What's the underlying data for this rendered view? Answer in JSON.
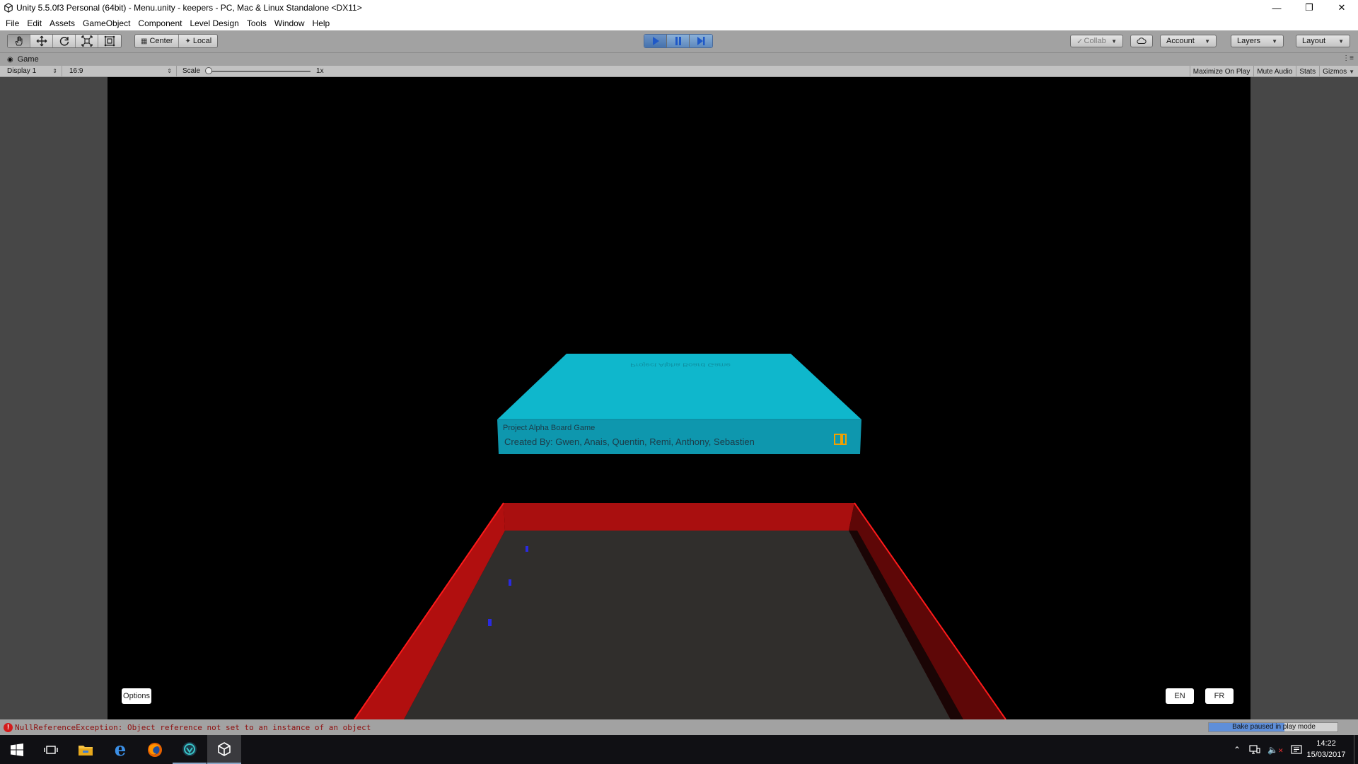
{
  "window": {
    "title": "Unity 5.5.0f3 Personal (64bit) - Menu.unity - keepers - PC, Mac & Linux Standalone <DX11>",
    "controls": [
      "minimize",
      "restore",
      "close"
    ]
  },
  "menu": [
    "File",
    "Edit",
    "Assets",
    "GameObject",
    "Component",
    "Level Design",
    "Tools",
    "Window",
    "Help"
  ],
  "toolbar": {
    "transform_tools": [
      {
        "name": "hand-tool",
        "icon": "hand-icon",
        "active": true
      },
      {
        "name": "move-tool",
        "icon": "move-icon",
        "active": false
      },
      {
        "name": "rotate-tool",
        "icon": "rotate-icon",
        "active": false
      },
      {
        "name": "scale-tool",
        "icon": "scale-icon",
        "active": false
      },
      {
        "name": "rect-tool",
        "icon": "rect-icon",
        "active": false
      }
    ],
    "pivot_label": "Center",
    "space_label": "Local",
    "play_state": "playing",
    "collab_label": "Collab",
    "account_label": "Account",
    "layers_label": "Layers",
    "layout_label": "Layout"
  },
  "game_view": {
    "tab_label": "Game",
    "display_label": "Display 1",
    "aspect_label": "16:9",
    "scale_label": "Scale",
    "scale_value": "1x",
    "toggles": [
      "Maximize On Play",
      "Mute Audio",
      "Stats",
      "Gizmos"
    ]
  },
  "game": {
    "box_top_text": "Project Alpha Board Game",
    "box_title": "Project Alpha Board Game",
    "credits": "Created By:  Gwen, Anais, Quentin, Remi, Anthony, Sebastien",
    "options_button": "Options",
    "lang_en": "EN",
    "lang_fr": "FR",
    "colors": {
      "box": "#0fb7cc",
      "box_front": "#0e96ad",
      "wall": "#a80f0f",
      "floor": "#302e2c"
    }
  },
  "status": {
    "error_message": "NullReferenceException: Object reference not set to an instance of an object",
    "bake_label": "Bake paused in play mode",
    "bake_progress": 0.58
  },
  "taskbar": {
    "apps": [
      "start-icon",
      "task-view-icon",
      "file-explorer-icon",
      "edge-icon",
      "firefox-icon",
      "app-icon",
      "unity-icon"
    ],
    "time": "14:22",
    "date": "15/03/2017"
  }
}
